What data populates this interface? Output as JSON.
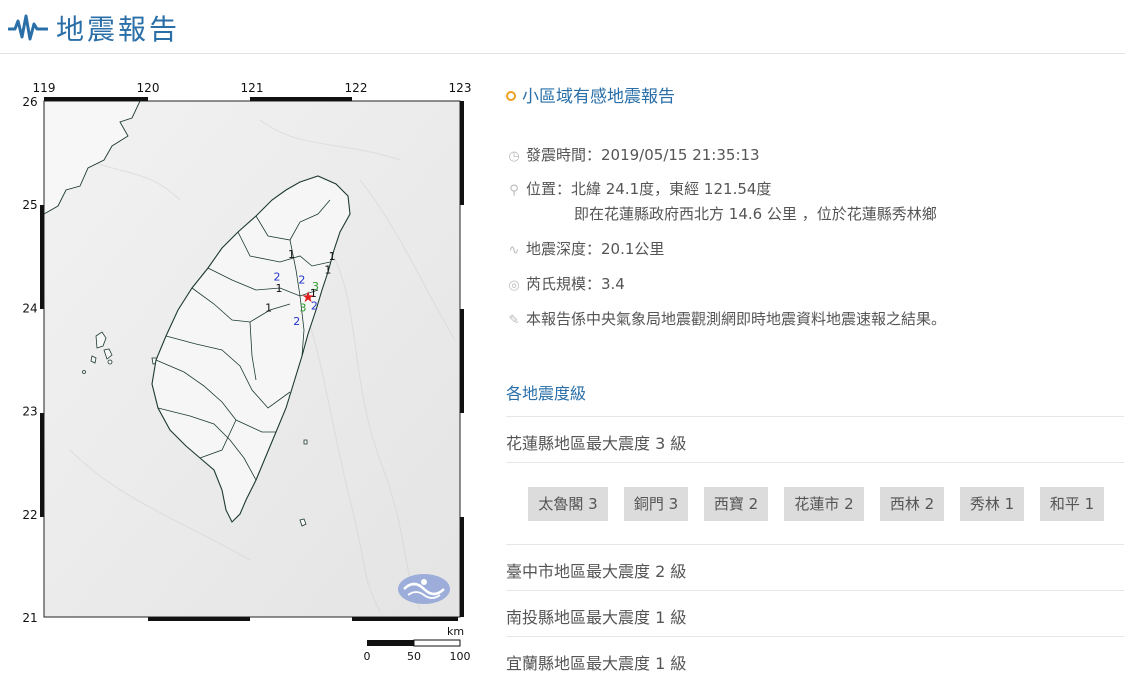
{
  "header": {
    "title": "地震報告"
  },
  "map": {
    "lon_ticks": [
      "119",
      "120",
      "121",
      "122",
      "123"
    ],
    "lat_ticks": [
      "26",
      "25",
      "24",
      "23",
      "22",
      "21"
    ],
    "scale_unit": "km",
    "scale_labels": [
      "0",
      "50",
      "100"
    ],
    "epicenter_color": "#e02020",
    "intensity_labels": [
      {
        "v": "1",
        "lon": 121.38,
        "lat": 24.48
      },
      {
        "v": "1",
        "lon": 121.77,
        "lat": 24.46
      },
      {
        "v": "1",
        "lon": 121.73,
        "lat": 24.33
      },
      {
        "v": "2",
        "lon": 121.24,
        "lat": 24.26
      },
      {
        "v": "1",
        "lon": 121.26,
        "lat": 24.15
      },
      {
        "v": "2",
        "lon": 121.48,
        "lat": 24.23
      },
      {
        "v": "3",
        "lon": 121.61,
        "lat": 24.17
      },
      {
        "v": "1",
        "lon": 121.59,
        "lat": 24.1
      },
      {
        "v": "3",
        "lon": 121.49,
        "lat": 23.96
      },
      {
        "v": "2",
        "lon": 121.6,
        "lat": 23.98
      },
      {
        "v": "1",
        "lon": 121.16,
        "lat": 23.96
      },
      {
        "v": "2",
        "lon": 121.43,
        "lat": 23.83
      }
    ]
  },
  "report": {
    "title": "小區域有感地震報告",
    "time_label": "發震時間：2019/05/15 21:35:13",
    "location_label": "位置：北緯 24.1度，東經 121.54度",
    "location_sub": "即在花蓮縣政府西北方 14.6 公里 ，位於花蓮縣秀林鄉",
    "depth_label": "地震深度：20.1公里",
    "magnitude_label": "芮氏規模：3.4",
    "note": "本報告係中央氣象局地震觀測網即時地震資料地震速報之結果。"
  },
  "intensity": {
    "section_title": "各地震度級",
    "regions": [
      {
        "label": "花蓮縣地區最大震度 3 級"
      },
      {
        "label": "臺中市地區最大震度 2 級"
      },
      {
        "label": "南投縣地區最大震度 1 級"
      },
      {
        "label": "宜蘭縣地區最大震度 1 級"
      }
    ],
    "stations": [
      {
        "label": "太魯閣 3"
      },
      {
        "label": "銅門 3"
      },
      {
        "label": "西寶 2"
      },
      {
        "label": "花蓮市 2"
      },
      {
        "label": "西林 2"
      },
      {
        "label": "秀林 1"
      },
      {
        "label": "和平 1"
      }
    ]
  },
  "colors": {
    "accent": "#2a6fa8",
    "orange": "#f0a020",
    "badge_bg": "#dcdcdc"
  }
}
